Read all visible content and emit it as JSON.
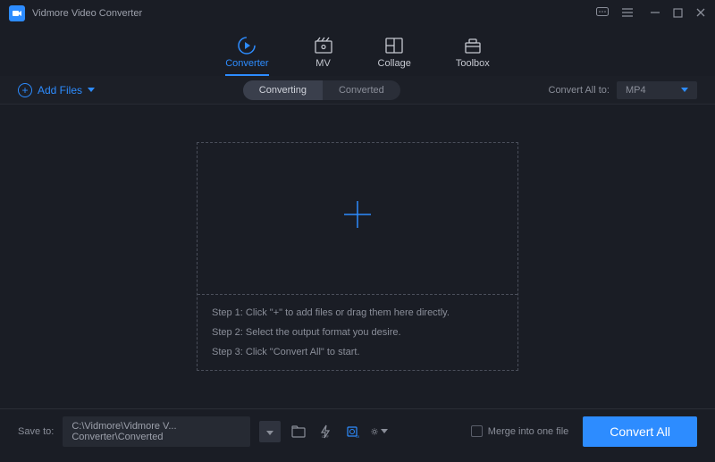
{
  "app": {
    "title": "Vidmore Video Converter"
  },
  "nav": {
    "converter": "Converter",
    "mv": "MV",
    "collage": "Collage",
    "toolbox": "Toolbox"
  },
  "toolbar": {
    "add_files": "Add Files",
    "converting_tab": "Converting",
    "converted_tab": "Converted",
    "convert_all_to": "Convert All to:",
    "format": "MP4"
  },
  "dropzone": {
    "step1": "Step 1: Click \"+\" to add files or drag them here directly.",
    "step2": "Step 2: Select the output format you desire.",
    "step3": "Step 3: Click \"Convert All\" to start."
  },
  "footer": {
    "save_to": "Save to:",
    "path": "C:\\Vidmore\\Vidmore V... Converter\\Converted",
    "merge": "Merge into one file",
    "convert_all": "Convert All"
  }
}
